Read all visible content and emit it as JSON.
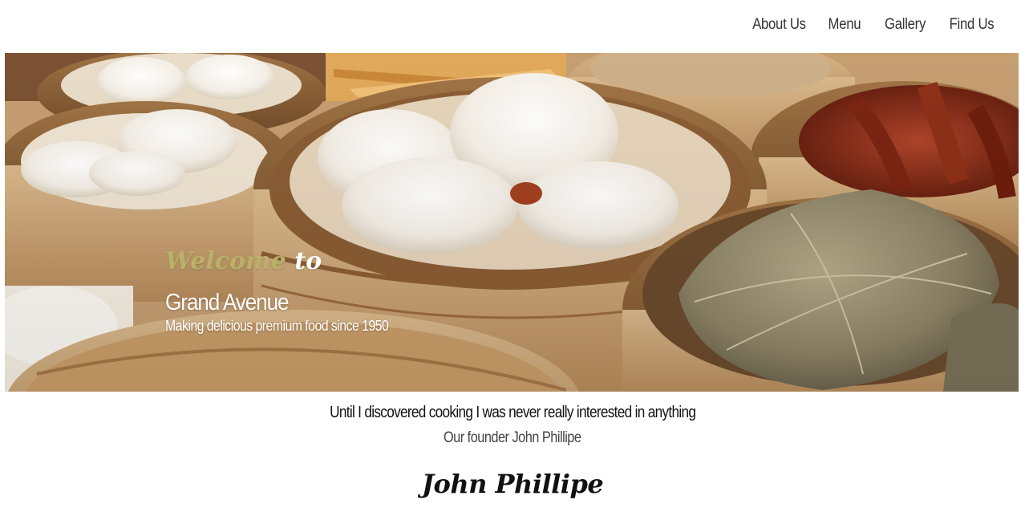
{
  "nav": {
    "items": [
      {
        "label": "About Us"
      },
      {
        "label": "Menu"
      },
      {
        "label": "Gallery"
      },
      {
        "label": "Find Us"
      }
    ]
  },
  "hero": {
    "welcome_word": "Welcome",
    "to_word": "to",
    "title": "Grand Avenue",
    "tagline": "Making delicious premium food since 1950",
    "image": "dim-sum-bamboo-steamers-photo"
  },
  "about": {
    "quote": "Until I discovered cooking I was never really interested in anything",
    "attribution": "Our founder John Phillipe",
    "signature": "John Phillipe"
  },
  "colors": {
    "accent": "#b9b168",
    "bamboo": "#c9a27a",
    "text": "#111111"
  }
}
